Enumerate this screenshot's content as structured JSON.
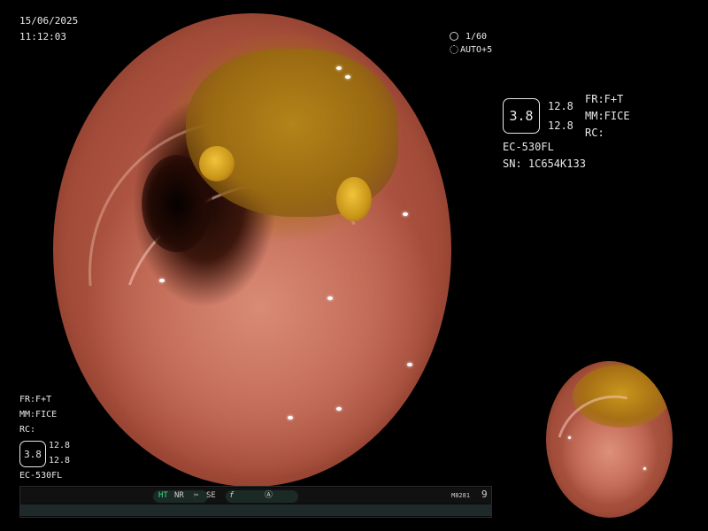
{
  "date": "15/06/2025",
  "time": "11:12:03",
  "capture": {
    "shutter": "1/60",
    "exposure": "AUTO+5",
    "shutter_icon": "shutter-icon",
    "exposure_icon": "exposure-icon"
  },
  "right_panel": {
    "badge": "3.8",
    "val1": "12.8",
    "val2": "12.8",
    "fr": "FR:F+T",
    "mm": "MM:FICE",
    "rc": "RC:",
    "scope": "EC-530FL",
    "serial": "SN: 1C654K133"
  },
  "left_panel": {
    "fr": "FR:F+T",
    "mm": "MM:FICE",
    "rc": "RC:",
    "badge": "3.8",
    "val1": "12.8",
    "val2": "12.8",
    "scope": "EC-530FL"
  },
  "status_bar": {
    "ht": "HT",
    "nr": "NR",
    "se": "SE",
    "se_icon": "scissors-icon",
    "fx_icon": "function-icon",
    "circle_icon": "circle-a-icon",
    "code": "M8281",
    "count": "9"
  }
}
